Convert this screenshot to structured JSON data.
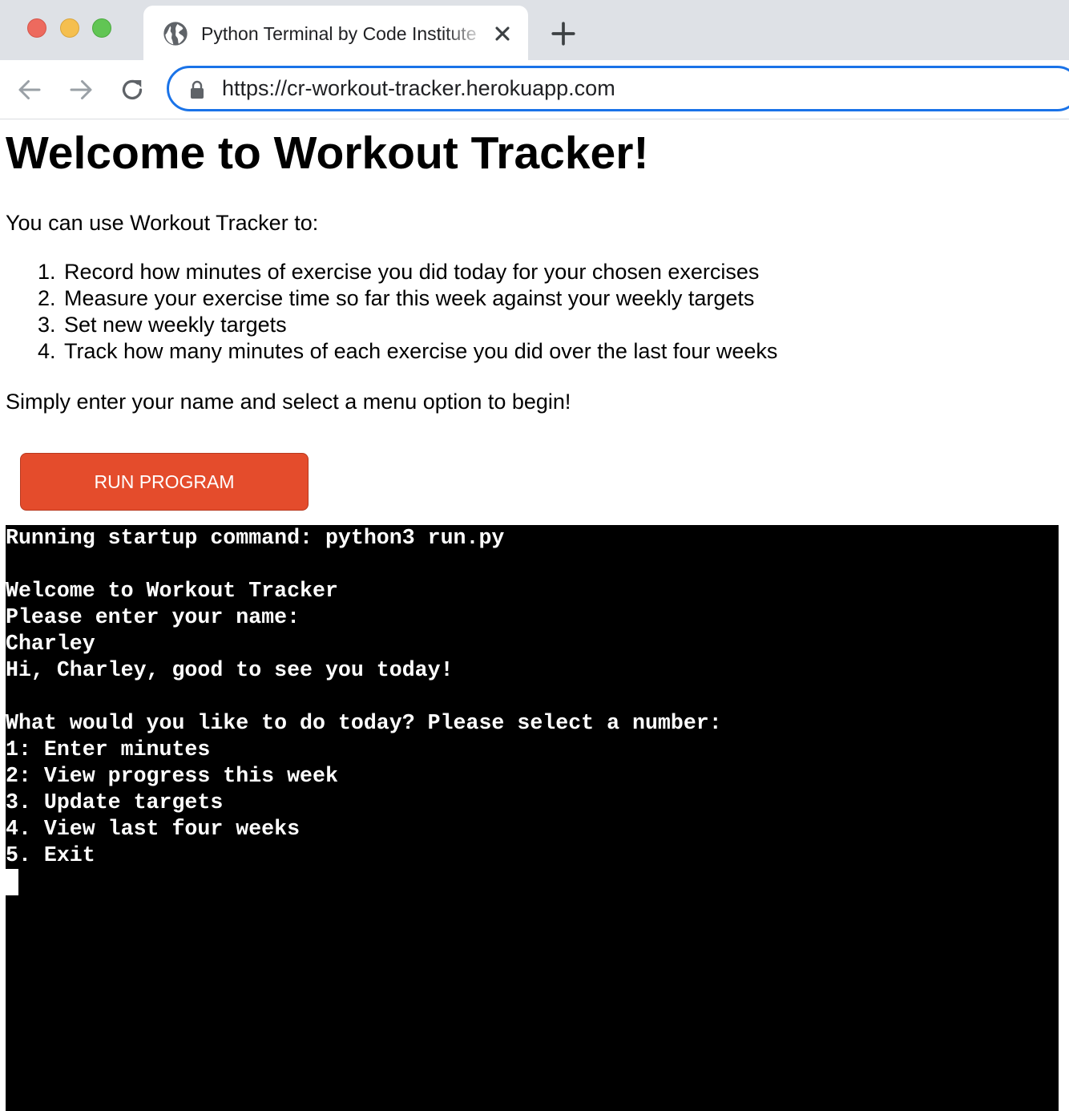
{
  "browser": {
    "tab_title": "Python Terminal by Code Institute",
    "url": "https://cr-workout-tracker.herokuapp.com",
    "icons": {
      "favicon": "globe-icon",
      "tab_close": "close-icon",
      "new_tab": "plus-icon",
      "back": "arrow-left-icon",
      "forward": "arrow-right-icon",
      "reload": "reload-icon",
      "secure": "lock-icon"
    },
    "colors": {
      "tabstrip": "#dee1e6",
      "omnibox_focus": "#1a73e8"
    }
  },
  "page": {
    "title": "Welcome to Workout Tracker!",
    "intro": "You can use Workout Tracker to:",
    "features": [
      {
        "num": "1.",
        "text": "Record how minutes of exercise you did today for your chosen exercises"
      },
      {
        "num": "2.",
        "text": "Measure your exercise time so far this week against your weekly targets"
      },
      {
        "num": "3.",
        "text": "Set new weekly targets"
      },
      {
        "num": "4.",
        "text": "Track how many minutes of each exercise you did over the last four weeks"
      }
    ],
    "cta": "Simply enter your name and select a menu option to begin!",
    "run_button": "RUN PROGRAM",
    "colors": {
      "run_button": "#e44c2c",
      "terminal_bg": "#000000",
      "terminal_fg": "#ffffff"
    }
  },
  "terminal": {
    "lines": [
      "Running startup command: python3 run.py",
      "",
      "Welcome to Workout Tracker",
      "Please enter your name:",
      "Charley",
      "Hi, Charley, good to see you today!",
      "",
      "What would you like to do today? Please select a number:",
      "1: Enter minutes",
      "2: View progress this week",
      "3. Update targets",
      "4. View last four weeks",
      "5. Exit"
    ]
  }
}
